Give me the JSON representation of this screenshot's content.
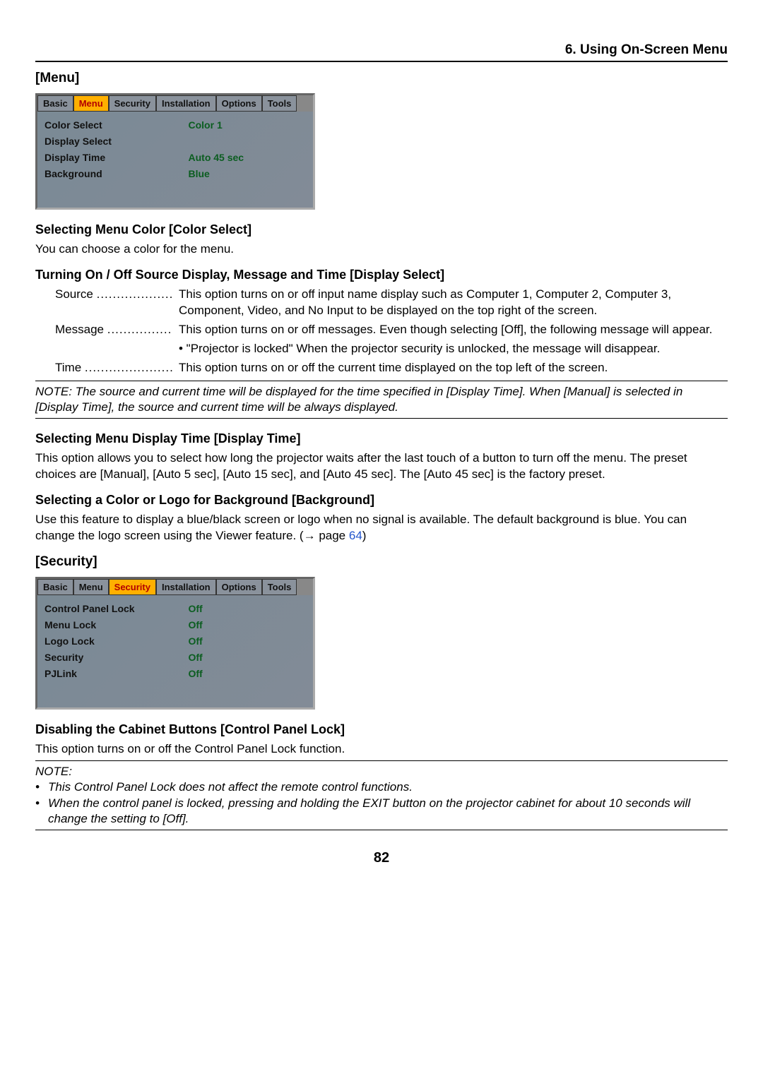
{
  "header": "6. Using On-Screen Menu",
  "menu_heading": "[Menu]",
  "menu_shot": {
    "tabs": [
      "Basic",
      "Menu",
      "Security",
      "Installation",
      "Options",
      "Tools"
    ],
    "active_tab": "Menu",
    "rows": [
      {
        "label": "Color Select",
        "value": "Color 1"
      },
      {
        "label": "Display Select",
        "value": ""
      },
      {
        "label": "Display Time",
        "value": "Auto 45 sec"
      },
      {
        "label": "Background",
        "value": "Blue"
      }
    ]
  },
  "color_select": {
    "heading": "Selecting Menu Color [Color Select]",
    "text": "You can choose a color for the menu."
  },
  "display_select": {
    "heading": "Turning On / Off Source Display, Message and Time [Display Select]",
    "source_term": "Source",
    "source_dots": "...................",
    "source_desc": "This option turns on or off input name display such as Computer 1, Computer 2, Computer 3, Component, Video, and No Input to be displayed on the top right of the screen.",
    "message_term": "Message",
    "message_dots": "................",
    "message_desc": "This option turns on or off messages. Even though selecting [Off], the following message will appear.",
    "message_sub": "• \"Projector is locked\" When the projector security is unlocked, the message will disappear.",
    "time_term": "Time",
    "time_dots": "......................",
    "time_desc": "This option turns on or off the current time displayed on the top left of the screen.",
    "note": "NOTE: The source and current time will be displayed for the time specified in [Display Time]. When [Manual] is selected in [Display Time], the source and current time will be always displayed."
  },
  "display_time": {
    "heading": "Selecting Menu Display Time [Display Time]",
    "text": "This option allows you to select how long the projector waits after the last touch of a button to turn off the menu. The preset choices are [Manual], [Auto 5 sec], [Auto 15 sec], and [Auto 45 sec]. The [Auto 45 sec] is the factory preset."
  },
  "background": {
    "heading": "Selecting a Color or Logo for Background [Background]",
    "text_pre": "Use this feature to display a blue/black screen or logo when no signal is available. The default background is blue. You can change the logo screen using the Viewer feature. (→ page ",
    "link": "64",
    "text_post": ")"
  },
  "security_heading": "[Security]",
  "security_shot": {
    "tabs": [
      "Basic",
      "Menu",
      "Security",
      "Installation",
      "Options",
      "Tools"
    ],
    "active_tab": "Security",
    "rows": [
      {
        "label": "Control Panel Lock",
        "value": "Off"
      },
      {
        "label": "Menu Lock",
        "value": "Off"
      },
      {
        "label": "Logo Lock",
        "value": "Off"
      },
      {
        "label": "Security",
        "value": "Off"
      },
      {
        "label": "PJLink",
        "value": "Off"
      }
    ]
  },
  "cpl": {
    "heading": "Disabling the Cabinet Buttons [Control Panel Lock]",
    "text": "This option turns on or off the Control Panel Lock function.",
    "note_label": "NOTE:",
    "note1": "This Control Panel Lock does not affect the remote control functions.",
    "note2": "When the control panel is locked, pressing and holding the EXIT button on the projector cabinet for about 10 seconds will change the setting to [Off]."
  },
  "page_number": "82"
}
